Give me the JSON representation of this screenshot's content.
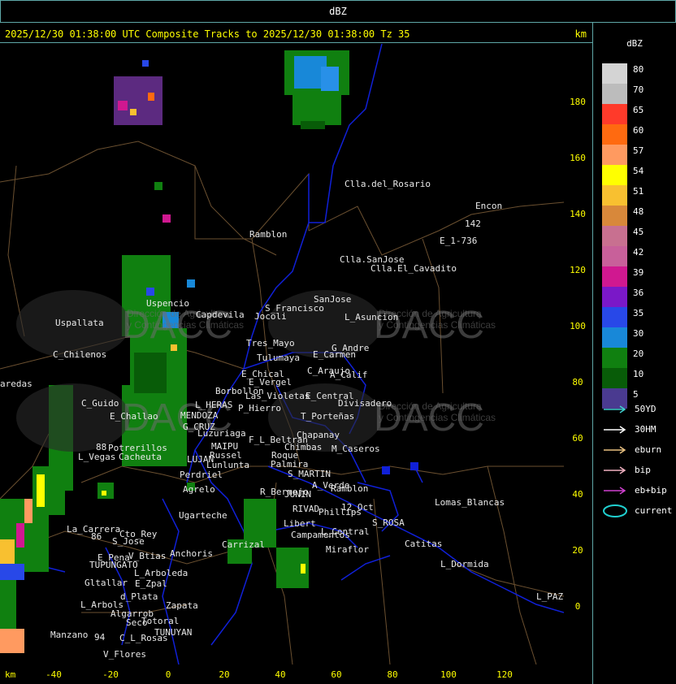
{
  "header": {
    "label": "dBZ"
  },
  "title": {
    "text": "2025/12/30 01:38:00 UTC Composite Tracks to 2025/12/30 01:38:00 Tz 35",
    "unit": "km"
  },
  "y_axis": {
    "unit": "km",
    "ticks": [
      "180",
      "160",
      "140",
      "120",
      "100",
      "80",
      "60",
      "40",
      "20",
      "0"
    ]
  },
  "x_axis": {
    "unit": "km",
    "ticks": [
      "-40",
      "-20",
      "0",
      "20",
      "40",
      "60",
      "80",
      "100",
      "120"
    ]
  },
  "legend": {
    "title": "dBZ",
    "scale": [
      {
        "label": "80",
        "color": "#d4d4d4"
      },
      {
        "label": "70",
        "color": "#bcbcbc"
      },
      {
        "label": "65",
        "color": "#ff3a2a"
      },
      {
        "label": "60",
        "color": "#ff6a10"
      },
      {
        "label": "57",
        "color": "#ff9a60"
      },
      {
        "label": "54",
        "color": "#ffff00"
      },
      {
        "label": "51",
        "color": "#f8c030"
      },
      {
        "label": "48",
        "color": "#d8883a"
      },
      {
        "label": "45",
        "color": "#c87090"
      },
      {
        "label": "42",
        "color": "#c8609a"
      },
      {
        "label": "39",
        "color": "#d01890"
      },
      {
        "label": "36",
        "color": "#7a18c8"
      },
      {
        "label": "35",
        "color": "#2848e8"
      },
      {
        "label": "30",
        "color": "#1888d8"
      },
      {
        "label": "20",
        "color": "#108010"
      },
      {
        "label": "10",
        "color": "#085c08"
      },
      {
        "label": "5",
        "color": "#4a3a90"
      }
    ],
    "tracks": [
      {
        "label": "50YD",
        "color": "#40d0d0"
      },
      {
        "label": "30HM",
        "color": "#ffffff"
      },
      {
        "label": "eburn",
        "color": "#e8c080"
      },
      {
        "label": "bip",
        "color": "#f0b0c0"
      },
      {
        "label": "eb+bip",
        "color": "#d040d0"
      },
      {
        "label": "current",
        "color": "#20d0d0"
      }
    ]
  },
  "watermark": {
    "brand": "DACC",
    "line1": "Dirección de Agricultura",
    "line2": "y Contingencias Climáticas"
  },
  "places": [
    "Clla.del_Rosario",
    "Encon",
    "142",
    "E_1-736",
    "Ramblon",
    "Clla.SanJose",
    "Clla.El_Cavadito",
    "Uspallata",
    "Uspencio",
    "Capdevila",
    "S_Francisco",
    "Jocoli",
    "SanJose",
    "L_Asuncion",
    "C_Chilenos",
    "Tres_Mayo",
    "Tulumaya",
    "G_Andre",
    "E_Carmen",
    "E_Chical",
    "E_Vergel",
    "C_Araujo",
    "A_Calif",
    "Borbollon",
    "Las_Violetas",
    "E_Central",
    "Divisadero",
    "L_HERAS",
    "P_Hierro",
    "T_Porteñas",
    "C_Guido",
    "E_Challao",
    "MENDOZA",
    "G_CRUZ",
    "Luzuriaga",
    "F_L_Beltran",
    "Chapanay",
    "MAIPU",
    "Russel",
    "Chimbas",
    "M_Caseros",
    "Potrerillos",
    "L_Vegas",
    "Cacheuta",
    "LUJAN",
    "Lunlunta",
    "Roque",
    "Palmira",
    "Perdriel",
    "S_MARTIN",
    "A_Verde",
    "Ramblon",
    "Agrelo",
    "R_Bermejo",
    "JUNIN",
    "Lomas_Blancas",
    "Ugarteche",
    "RIVAD",
    "Phillips",
    "12_Oct",
    "S_ROSA",
    "La_Carrera",
    "Cto_Rey",
    "S_Jose",
    "Libert",
    "Campamentos",
    "L_Central",
    "Carrizal",
    "Catitas",
    "E_Pena",
    "V_Btias",
    "Anchoris",
    "TUPUNGATO",
    "Miraflor",
    "L_Dormida",
    "L_Arboleda",
    "Gltallar",
    "E_Zpal",
    "d_Plata",
    "L_Arbols",
    "Zapata",
    "Algarrob",
    "Seco",
    "Totoral",
    "TUNUYAN",
    "Manzano",
    "C_L_Rosas",
    "V_Flores",
    "L_PAZ",
    "aredas",
    "88",
    "94",
    "86"
  ]
}
